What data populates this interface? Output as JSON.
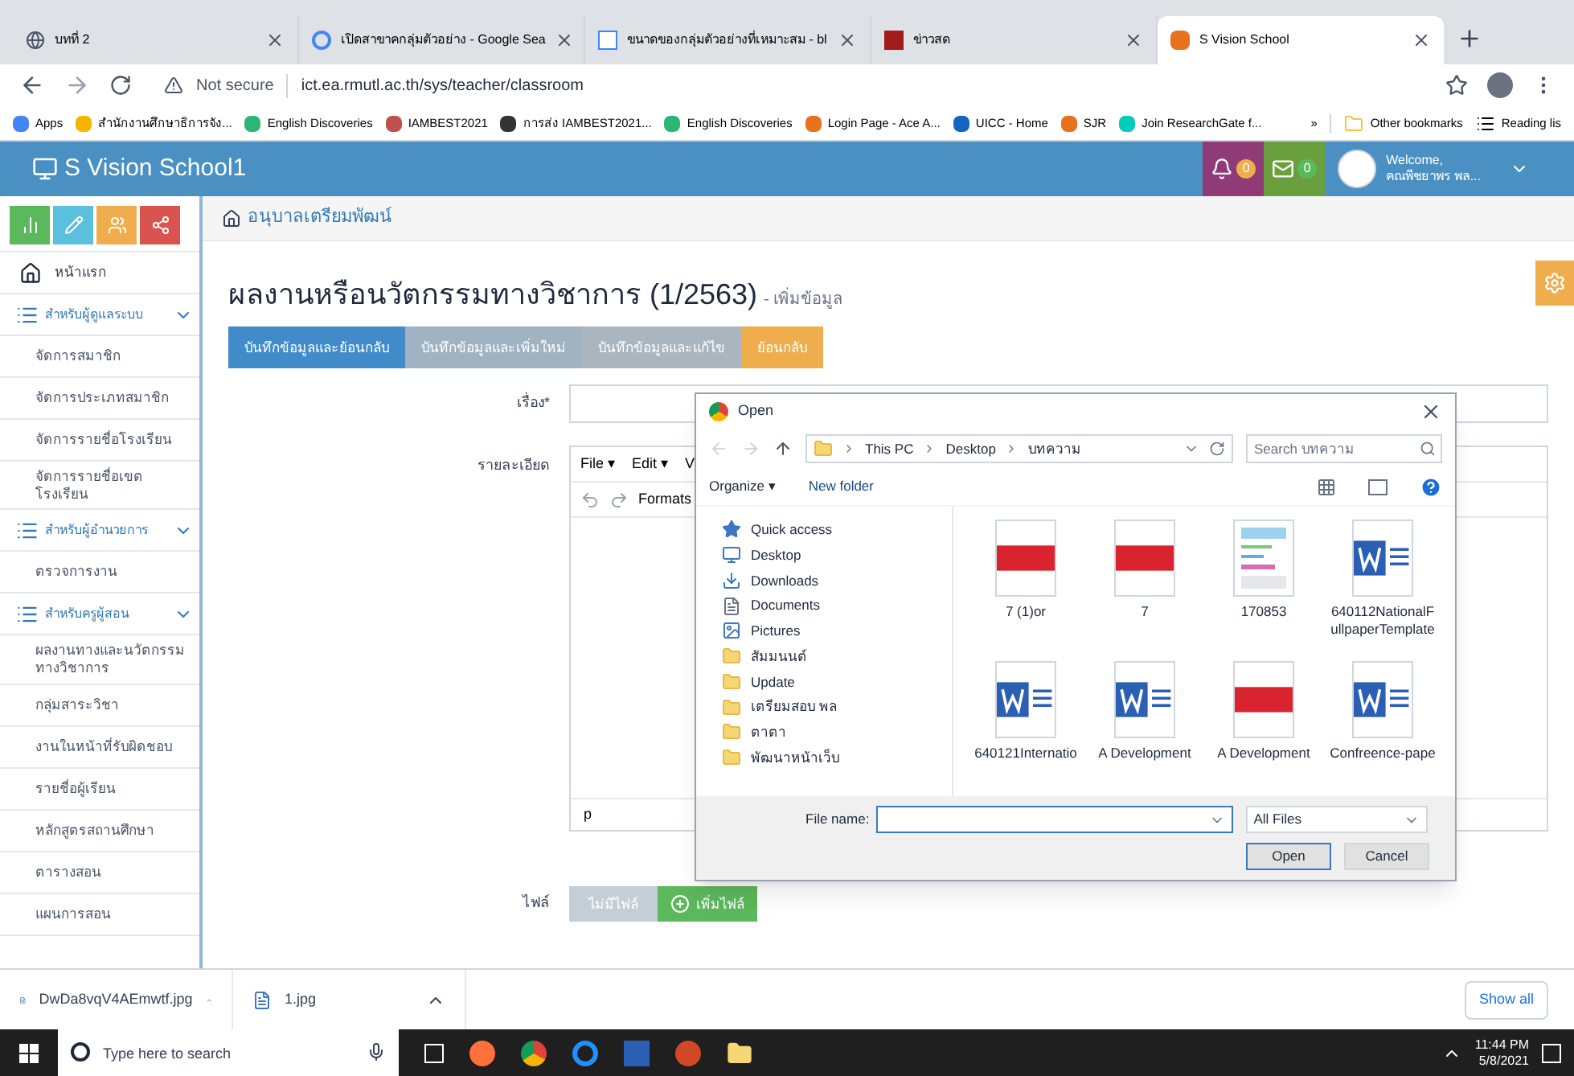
{
  "browser": {
    "tabs": [
      {
        "label": "บทที่ 2",
        "selected": false,
        "kind": "globe"
      },
      {
        "label": "เปิดสาขาคกลุ่มตัวอย่าง - Google Sea",
        "selected": false,
        "kind": "google"
      },
      {
        "label": "ขนาดของกลุ่มตัวอย่างที่เหมาะสม - bl",
        "selected": false,
        "kind": "doc"
      },
      {
        "label": "ข่าวสด",
        "selected": false,
        "kind": "k"
      },
      {
        "label": "S Vision School",
        "selected": true,
        "kind": "site"
      }
    ],
    "security": "Not secure",
    "url": "ict.ea.rmutl.ac.th/sys/teacher/classroom",
    "bookmarks": [
      {
        "label": "Apps",
        "color": "#4285f4"
      },
      {
        "label": "สำนักงานศึกษาธิการจัง...",
        "color": "#f4b400"
      },
      {
        "label": "English Discoveries",
        "color": "#2bb673"
      },
      {
        "label": "IAMBEST2021",
        "color": "#c0504d"
      },
      {
        "label": "การส่ง IAMBEST2021...",
        "color": "#333333"
      },
      {
        "label": "English Discoveries",
        "color": "#2bb673"
      },
      {
        "label": "Login Page - Ace A...",
        "color": "#e8711c"
      },
      {
        "label": "UICC - Home",
        "color": "#1565c0"
      },
      {
        "label": "SJR",
        "color": "#e8711c"
      },
      {
        "label": "Join ResearchGate f...",
        "color": "#00ccbb"
      }
    ],
    "overflow": "»",
    "other_bookmarks": "Other bookmarks",
    "reading_list": "Reading lis"
  },
  "header": {
    "brand": "S Vision School1",
    "notifications": "0",
    "messages": "0",
    "welcome": "Welcome,",
    "user": "คณพีชยาพร พล..."
  },
  "sidebar": {
    "home": "หน้าแรก",
    "sections": [
      {
        "title": "สำหรับผู้ดูแลระบบ",
        "expanded": true,
        "items": [
          "จัดการสมาชิก",
          "จัดการประเภทสมาชิก",
          "จัดการรายชื่อโรงเรียน",
          "จัดการรายชื่อเขตโรงเรียน"
        ]
      },
      {
        "title": "สำหรับผู้อำนวยการ",
        "expanded": true,
        "items": [
          "ตรวจการงาน"
        ]
      },
      {
        "title": "สำหรับครูผู้สอน",
        "expanded": true,
        "items": [
          "ผลงานทางและนวัตกรรมทางวิชาการ",
          "กลุ่มสาระวิชา",
          "งานในหน้าที่รับผิดชอบ",
          "รายชื่อผู้เรียน",
          "หลักสูตรสถานศึกษา",
          "ตารางสอน",
          "แผนการสอน"
        ]
      }
    ]
  },
  "breadcrumb": "อนุบาลเตรียมพัฒน์",
  "page": {
    "title": "ผลงานหรือนวัตกรรมทางวิชาการ (1/2563)",
    "subtitle": "- เพิ่มข้อมูล"
  },
  "actions": [
    {
      "label": "บันทึกข้อมูลและย้อนกลับ",
      "kind": "primary"
    },
    {
      "label": "บันทึกข้อมูลและเพิ่มใหม่",
      "kind": "secondary"
    },
    {
      "label": "บันทึกข้อมูลและแก้ไข",
      "kind": "muted"
    },
    {
      "label": "ย้อนกลับ",
      "kind": "warning"
    }
  ],
  "form": {
    "subject_label": "เรื่อง*",
    "detail_label": "รายละเอียด",
    "editor_menu": [
      "File ▾",
      "Edit ▾",
      "V"
    ],
    "editor_format": "Formats",
    "editor_status": "p",
    "file_label": "ไฟล์",
    "no_file": "ไม่มีไฟล์",
    "add_file": "เพิ่มไฟล์"
  },
  "dialog": {
    "title": "Open",
    "path": [
      "This PC",
      "Desktop",
      "บทความ"
    ],
    "search": {
      "placeholder": "Search บทความ"
    },
    "organize": "Organize ▾",
    "new_folder": "New folder",
    "nav": [
      {
        "label": "Quick access",
        "kind": "star"
      },
      {
        "label": "Desktop",
        "kind": "desktop"
      },
      {
        "label": "Downloads",
        "kind": "download"
      },
      {
        "label": "Documents",
        "kind": "document"
      },
      {
        "label": "Pictures",
        "kind": "picture"
      },
      {
        "label": "สัมมนนต์",
        "kind": "folder"
      },
      {
        "label": "Update",
        "kind": "folder"
      },
      {
        "label": "เตรียมสอบ พล",
        "kind": "folder"
      },
      {
        "label": "ตาตา",
        "kind": "folder"
      },
      {
        "label": "พัฒนาหน้าเว็บ",
        "kind": "folder"
      }
    ],
    "files": [
      {
        "name": "7 (1)or",
        "kind": "pdf"
      },
      {
        "name": "7",
        "kind": "pdf"
      },
      {
        "name": "170853",
        "kind": "image"
      },
      {
        "name": "640112NationalFullpaperTemplate",
        "kind": "word"
      },
      {
        "name": "640121Internatio",
        "kind": "word"
      },
      {
        "name": "A Development",
        "kind": "word"
      },
      {
        "name": "A Development",
        "kind": "pdf"
      },
      {
        "name": "Confreence-pape",
        "kind": "word"
      }
    ],
    "file_name_label": "File name:",
    "file_type": "All Files",
    "open": "Open",
    "cancel": "Cancel"
  },
  "downloads": [
    {
      "name": "DwDa8vqV4AEmwtf.jpg"
    },
    {
      "name": "1.jpg"
    }
  ],
  "show_all": "Show all",
  "taskbar": {
    "search": {
      "placeholder": "Type here to search"
    },
    "time": "11:44 PM",
    "date": "5/8/2021"
  }
}
